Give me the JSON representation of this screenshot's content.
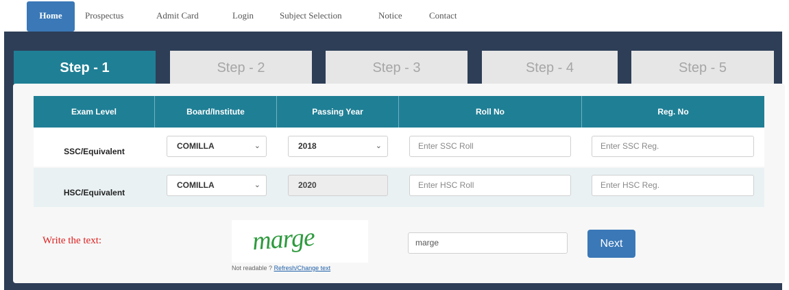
{
  "nav": {
    "items": [
      {
        "label": "Home",
        "active": true
      },
      {
        "label": "Prospectus"
      },
      {
        "label": "Admit Card"
      },
      {
        "label": "Login"
      },
      {
        "label": "Subject Selection"
      },
      {
        "label": "Notice"
      },
      {
        "label": "Contact"
      }
    ]
  },
  "steps": [
    {
      "label": "Step - 1",
      "active": true
    },
    {
      "label": "Step - 2"
    },
    {
      "label": "Step - 3"
    },
    {
      "label": "Step - 4"
    },
    {
      "label": "Step - 5"
    }
  ],
  "table": {
    "headers": [
      "Exam Level",
      "Board/Institute",
      "Passing Year",
      "Roll No",
      "Reg. No"
    ],
    "rows": [
      {
        "exam_level": "SSC/Equivalent",
        "board": "COMILLA",
        "passing_year": "2018",
        "roll_placeholder": "Enter SSC Roll",
        "reg_placeholder": "Enter SSC Reg."
      },
      {
        "exam_level": "HSC/Equivalent",
        "board": "COMILLA",
        "passing_year": "2020",
        "roll_placeholder": "Enter HSC Roll",
        "reg_placeholder": "Enter HSC Reg."
      }
    ]
  },
  "captcha": {
    "prompt": "Write the text:",
    "word": "marge",
    "help_text": "Not readable ?",
    "refresh_link": "Refresh/Change text",
    "input_value": "marge",
    "next_label": "Next"
  },
  "colors": {
    "teal": "#1f7f95",
    "blue": "#3a78b7",
    "dark_panel": "#2e3e57",
    "prompt_red": "#e02020",
    "captcha_green": "#2e9a3e"
  }
}
